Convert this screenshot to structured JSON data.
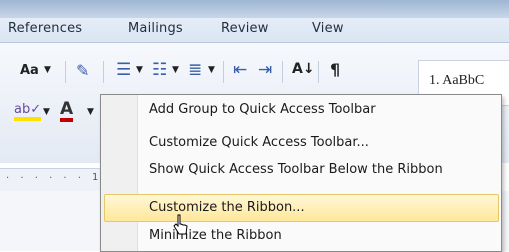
{
  "tabs": [
    "References",
    "Mailings",
    "Review",
    "View"
  ],
  "ribbon": {
    "font_size_btn": "Aa",
    "pilcrow": "¶",
    "sort": "A↓",
    "style_preview": "1. AaBbC",
    "font_color_letter": "A"
  },
  "ruler": {
    "mark": "1"
  },
  "menu": {
    "items": [
      "Add Group to Quick Access Toolbar",
      "Customize Quick Access Toolbar...",
      "Show Quick Access Toolbar Below the Ribbon",
      "Customize the Ribbon...",
      "Minimize the Ribbon"
    ],
    "highlighted_index": 3
  },
  "colors": {
    "highlight": "#ffe79a",
    "font_color": "#c00000",
    "highlighter": "#ffe100"
  }
}
